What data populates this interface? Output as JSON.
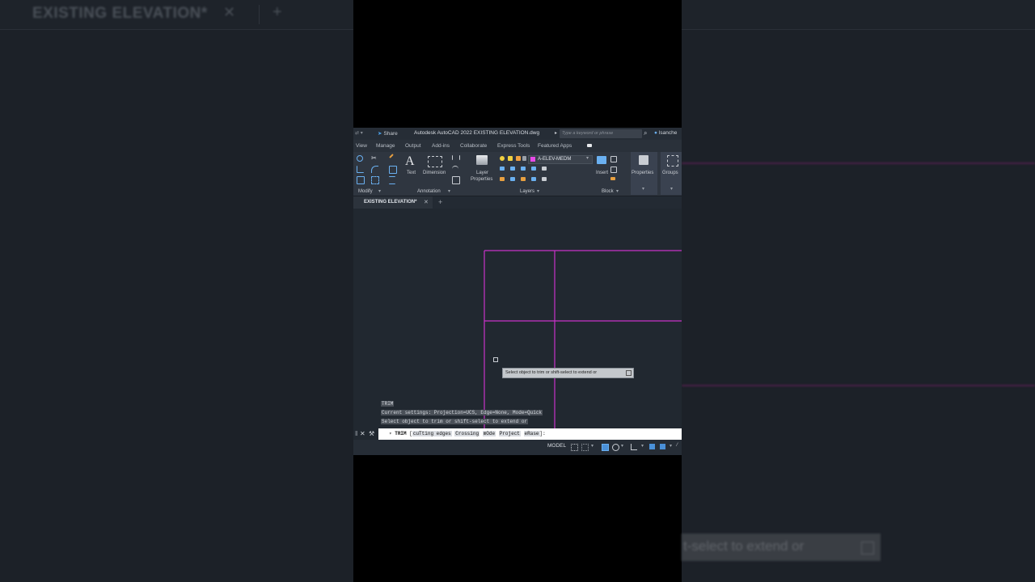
{
  "background": {
    "left_tab": "EXISTING ELEVATION*",
    "right_tooltip": "t-select to extend or"
  },
  "titlebar": {
    "share": "Share",
    "title": "Autodesk AutoCAD 2022   EXISTING ELEVATION.dwg",
    "search_placeholder": "Type a keyword or phrase",
    "user": "lsanche"
  },
  "menubar": [
    "View",
    "Manage",
    "Output",
    "Add-ins",
    "Collaborate",
    "Express Tools",
    "Featured Apps"
  ],
  "ribbon": {
    "modify_label": "Modify",
    "annotation_label": "Annotation",
    "text_label": "Text",
    "dimension_label": "Dimension",
    "layer_properties_label": "Layer Properties",
    "current_layer": "A-ELEV-MEDM",
    "layers_label": "Layers",
    "insert_label": "Insert",
    "block_label": "Block",
    "properties_label": "Properties",
    "groups_label": "Groups",
    "colors": {
      "layer_swatch": "#e84ae8"
    }
  },
  "doc_tab": {
    "label": "EXISTING ELEVATION*"
  },
  "canvas": {
    "line_color": "#c832c8",
    "tooltip": "Select object to trim or shift-select to extend or"
  },
  "history": {
    "line1": "TRIM",
    "line2": "Current settings: Projection=UCS, Edge=None, Mode=Quick",
    "line3": "Select object to trim or shift-select to extend or"
  },
  "command": {
    "cmd": "TRIM",
    "bracket_open": "[",
    "opt1": "cuTting edges",
    "opt2": "Crossing",
    "opt3": "mOde",
    "opt4": "Project",
    "opt5": "eRase",
    "bracket_close": "]:"
  },
  "statusbar": {
    "model": "MODEL"
  }
}
